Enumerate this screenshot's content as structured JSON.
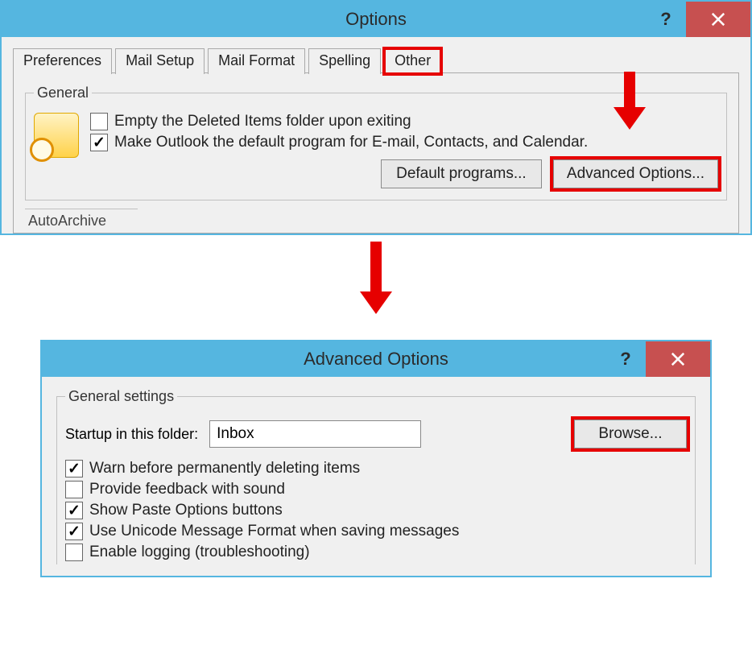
{
  "options_window": {
    "title": "Options",
    "tabs": {
      "preferences": "Preferences",
      "mail_setup": "Mail Setup",
      "mail_format": "Mail Format",
      "spelling": "Spelling",
      "other": "Other"
    },
    "general": {
      "legend": "General",
      "empty_deleted": {
        "label": "Empty the Deleted Items folder upon exiting",
        "checked": false
      },
      "make_default": {
        "label": "Make Outlook the default program for E-mail, Contacts, and Calendar.",
        "checked": true
      },
      "default_programs_btn": "Default programs...",
      "advanced_options_btn": "Advanced Options..."
    },
    "autoarchive_stub": "AutoArchive"
  },
  "advanced_window": {
    "title": "Advanced Options",
    "general_settings": {
      "legend": "General settings",
      "startup_label": "Startup in this folder:",
      "startup_value": "Inbox",
      "browse_btn": "Browse...",
      "warn_delete": {
        "label": "Warn before permanently deleting items",
        "checked": true
      },
      "feedback_sound": {
        "label": "Provide feedback with sound",
        "checked": false
      },
      "paste_options": {
        "label": "Show Paste Options buttons",
        "checked": true
      },
      "unicode_format": {
        "label": "Use Unicode Message Format when saving messages",
        "checked": true
      },
      "enable_logging": {
        "label": "Enable logging (troubleshooting)",
        "checked": false
      }
    }
  }
}
